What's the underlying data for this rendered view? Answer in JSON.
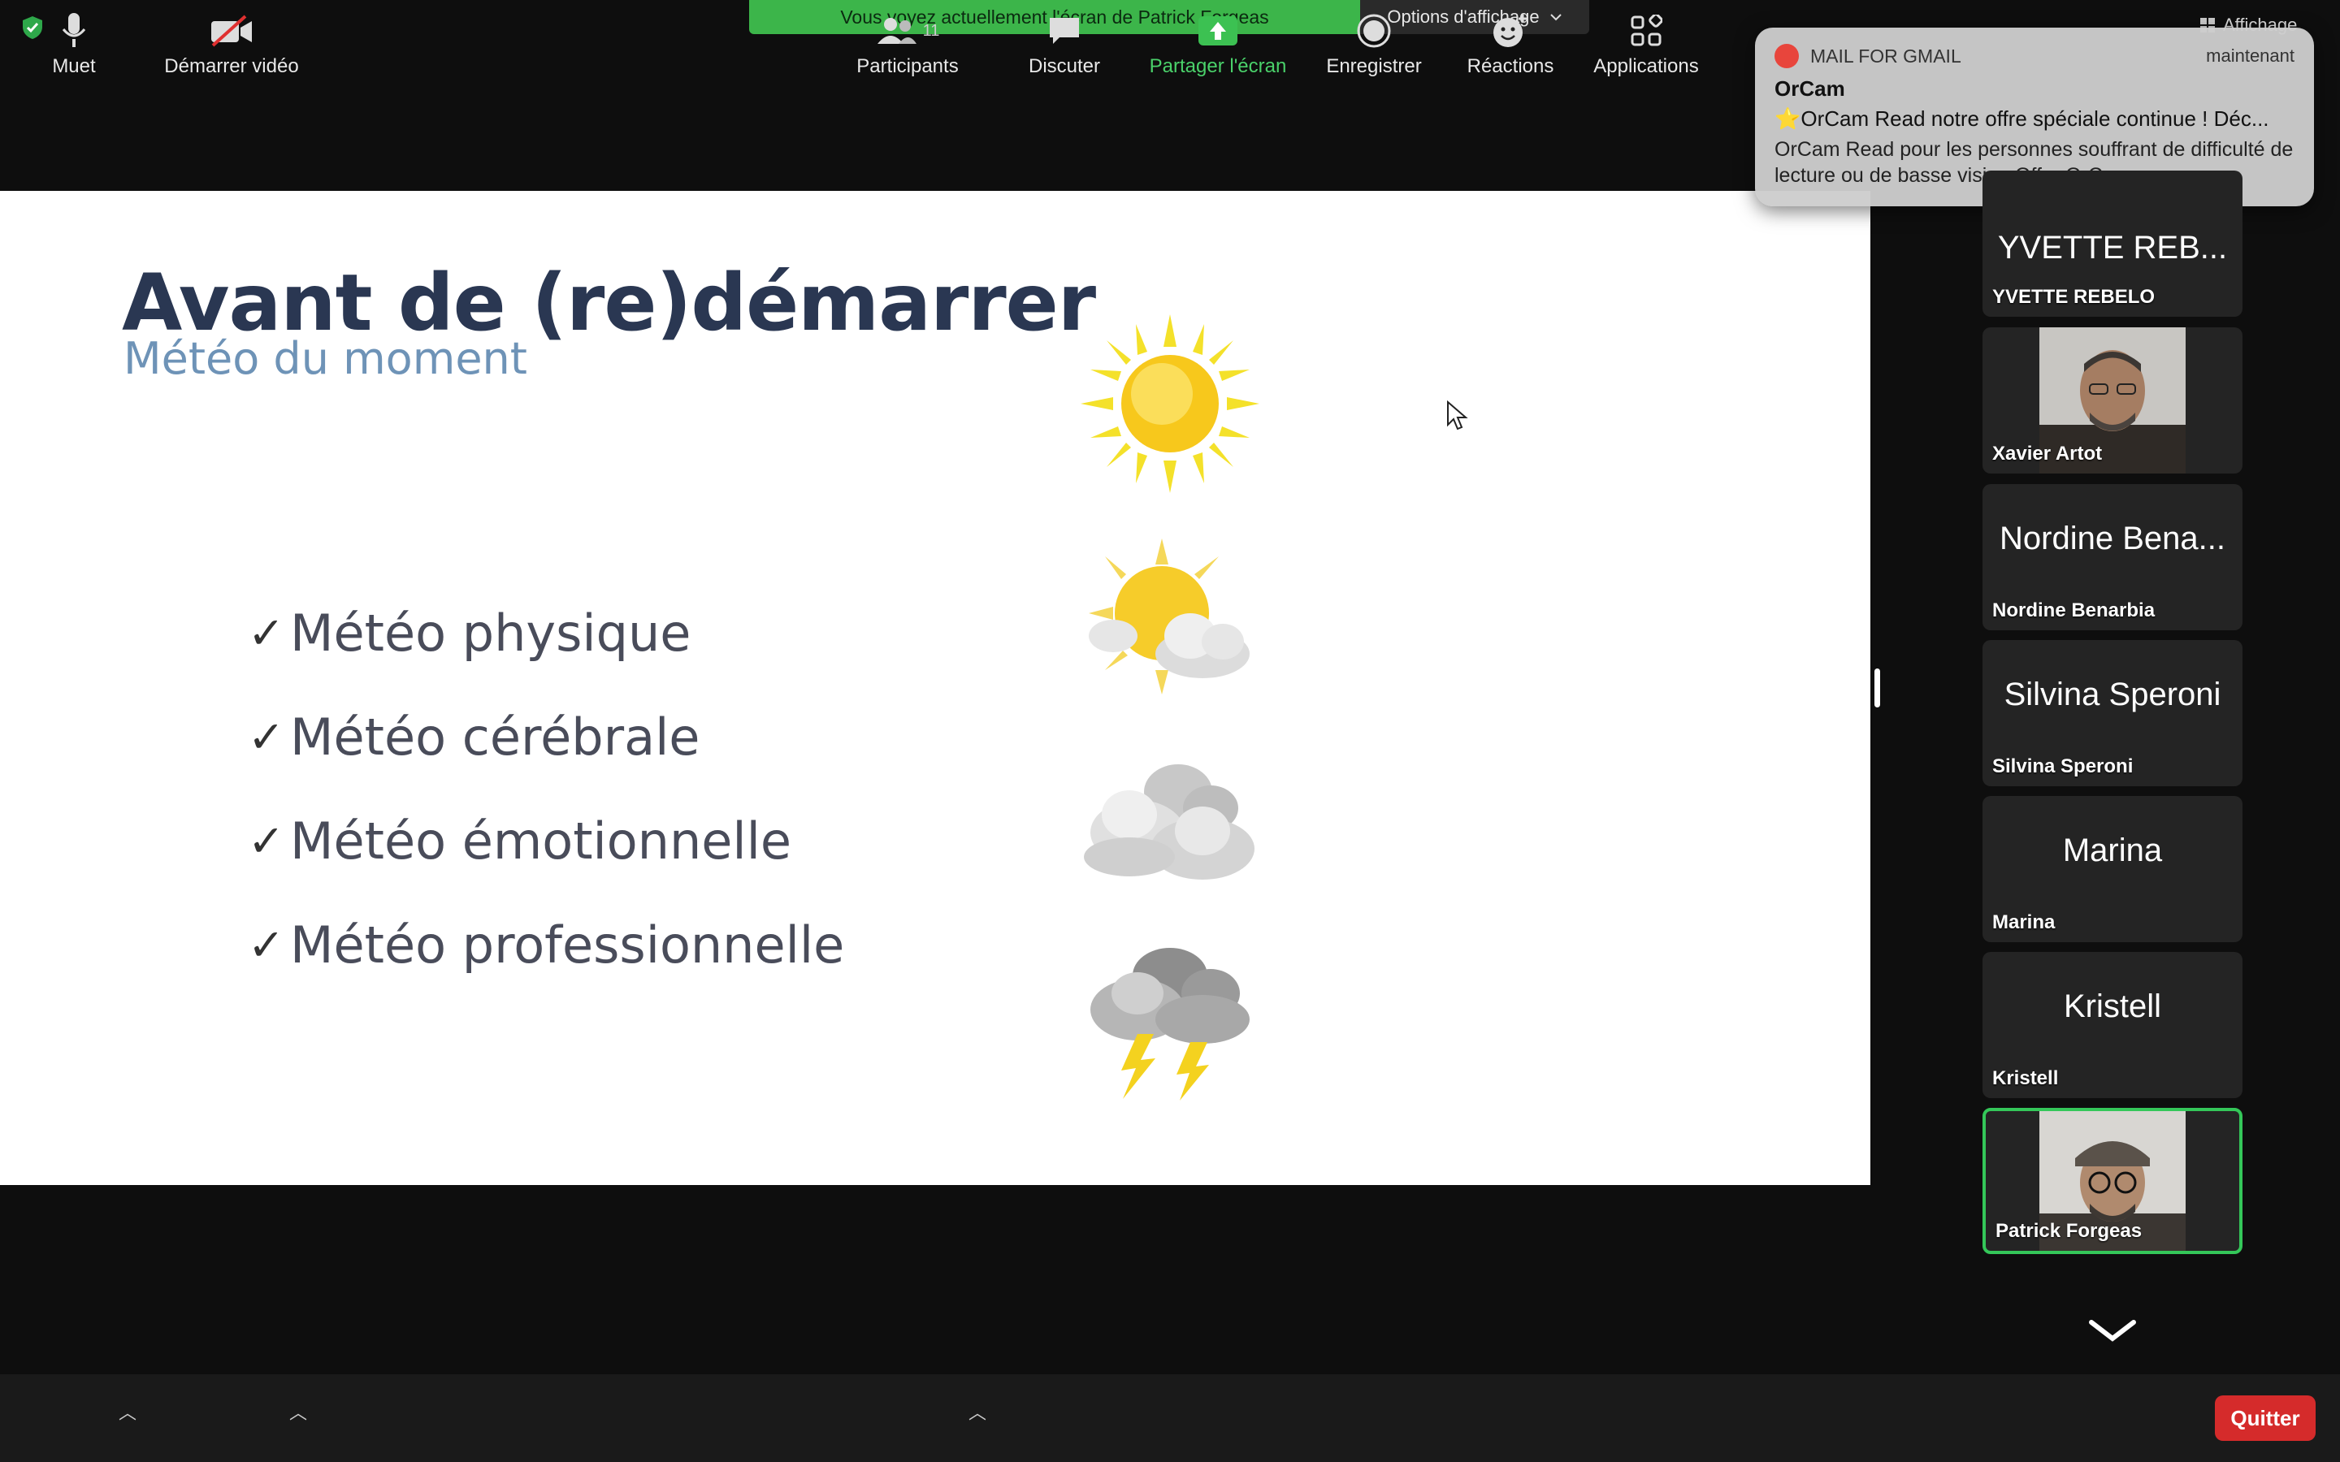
{
  "banner": {
    "viewing_text": "Vous voyez actuellement l'écran de Patrick Forgeas",
    "options_label": "Options d'affichage"
  },
  "top_right": {
    "affichage_label": "Affichage"
  },
  "slide": {
    "title": "Avant de (re)démarrer",
    "subtitle": "Météo du moment",
    "items": [
      {
        "check": "✓",
        "label": "Météo physique"
      },
      {
        "check": "✓",
        "label": "Météo cérébrale"
      },
      {
        "check": "✓",
        "label": "Météo émotionnelle"
      },
      {
        "check": "✓",
        "label": " Météo professionnelle"
      }
    ],
    "weather_icons": [
      "sun-icon",
      "sun-cloud-icon",
      "clouds-icon",
      "storm-icon"
    ]
  },
  "notification": {
    "app": "MAIL FOR GMAIL",
    "time": "maintenant",
    "sender": "OrCam",
    "subject": "⭐OrCam Read notre offre spéciale continue ! Déc...",
    "body": "OrCam Read pour les personnes souffrant de difficulté de lecture ou de basse vision Offre OrCa..."
  },
  "participants": [
    {
      "big": "YVETTE REB...",
      "small": "YVETTE REBELO",
      "video": false
    },
    {
      "big": "",
      "small": "Xavier Artot",
      "video": true
    },
    {
      "big": "Nordine Bena...",
      "small": "Nordine Benarbia",
      "video": false
    },
    {
      "big": "Silvina Speroni",
      "small": "Silvina Speroni",
      "video": false
    },
    {
      "big": "Marina",
      "small": "Marina",
      "video": false
    },
    {
      "big": "Kristell",
      "small": "Kristell",
      "video": false
    },
    {
      "big": "",
      "small": "Patrick Forgeas",
      "video": true,
      "active": true
    }
  ],
  "toolbar": {
    "mute": "Muet",
    "video": "Démarrer vidéo",
    "participants": "Participants",
    "participants_count": "11",
    "chat": "Discuter",
    "share": "Partager l'écran",
    "record": "Enregistrer",
    "reactions": "Réactions",
    "apps": "Applications",
    "quit": "Quitter"
  },
  "colors": {
    "share_green": "#3cb54a",
    "quit_red": "#d52b2b",
    "slide_title": "#2a3752",
    "slide_subtitle": "#6e93b7",
    "active_border": "#34c759"
  }
}
